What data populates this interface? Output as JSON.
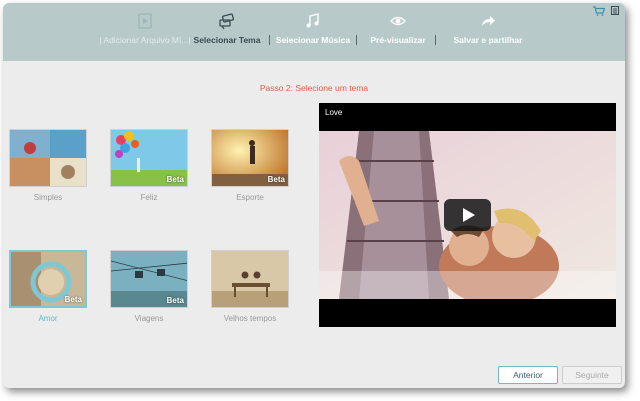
{
  "steps": [
    {
      "label": "| Adicionar Arquivo Mí...|",
      "icon": "video-file-icon",
      "state": "dim"
    },
    {
      "label": "Selecionar Tema",
      "icon": "theme-icon",
      "state": "active"
    },
    {
      "label": "Selecionar Música",
      "icon": "music-note-icon",
      "state": "normal"
    },
    {
      "label": "Pré-visualizar",
      "icon": "eye-icon",
      "state": "normal"
    },
    {
      "label": "Salvar e partilhar",
      "icon": "share-arrow-icon",
      "state": "normal"
    }
  ],
  "separators": [
    "|",
    "|",
    "|"
  ],
  "top_icons": {
    "cart": "cart-icon",
    "menu": "menu-icon"
  },
  "headline": "Passo 2: Selecione um tema",
  "themes": [
    {
      "name": "Simples",
      "beta": "",
      "selected": false
    },
    {
      "name": "Feliz",
      "beta": "Beta",
      "selected": false
    },
    {
      "name": "Esporte",
      "beta": "Beta",
      "selected": false
    },
    {
      "name": "Amor",
      "beta": "Beta",
      "selected": true
    },
    {
      "name": "Viagens",
      "beta": "Beta",
      "selected": false
    },
    {
      "name": "Velhos tempos",
      "beta": "",
      "selected": false
    }
  ],
  "preview": {
    "title": "Love",
    "play_icon": "play-icon"
  },
  "buttons": {
    "previous": "Anterior",
    "next": "Seguinte"
  },
  "colors": {
    "topbar": "#b8c9ca",
    "headline": "#e06040",
    "accent": "#7ec8d6"
  }
}
